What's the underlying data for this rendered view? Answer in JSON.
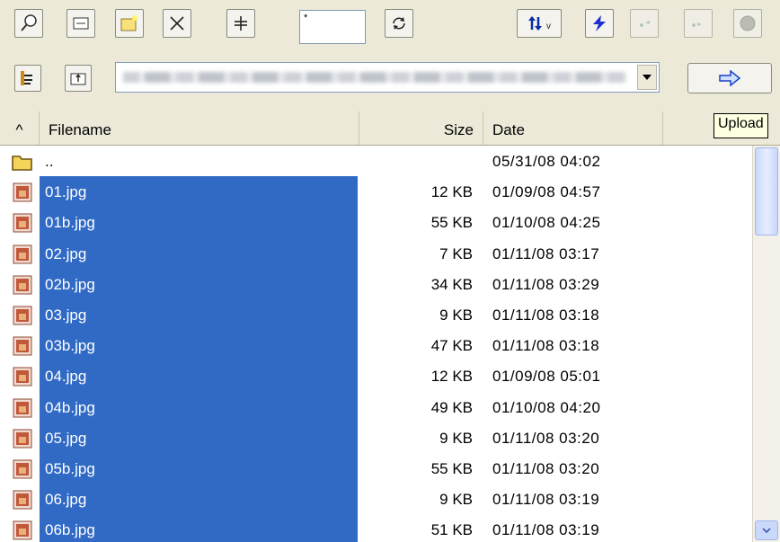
{
  "toolbar": {
    "filemask_value": "*",
    "buttons": [
      "find-icon",
      "window-icon",
      "new-folder-icon",
      "delete-icon",
      "split-icon",
      "refresh-icon",
      "sort-icon",
      "lightning-icon",
      "sync-left-icon",
      "sync-right-icon",
      "stop-icon"
    ]
  },
  "pathbar": {
    "upload_tooltip": "Upload"
  },
  "columns": {
    "sort": "^",
    "filename": "Filename",
    "size": "Size",
    "date": "Date"
  },
  "files": [
    {
      "name": "..",
      "size": "",
      "date": "05/31/08  04:02",
      "type": "folder",
      "selected": false
    },
    {
      "name": "01.jpg",
      "size": "12 KB",
      "date": "01/09/08  04:57",
      "type": "image",
      "selected": true
    },
    {
      "name": "01b.jpg",
      "size": "55 KB",
      "date": "01/10/08  04:25",
      "type": "image",
      "selected": true
    },
    {
      "name": "02.jpg",
      "size": "7 KB",
      "date": "01/11/08  03:17",
      "type": "image",
      "selected": true
    },
    {
      "name": "02b.jpg",
      "size": "34 KB",
      "date": "01/11/08  03:29",
      "type": "image",
      "selected": true
    },
    {
      "name": "03.jpg",
      "size": "9 KB",
      "date": "01/11/08  03:18",
      "type": "image",
      "selected": true
    },
    {
      "name": "03b.jpg",
      "size": "47 KB",
      "date": "01/11/08  03:18",
      "type": "image",
      "selected": true
    },
    {
      "name": "04.jpg",
      "size": "12 KB",
      "date": "01/09/08  05:01",
      "type": "image",
      "selected": true
    },
    {
      "name": "04b.jpg",
      "size": "49 KB",
      "date": "01/10/08  04:20",
      "type": "image",
      "selected": true
    },
    {
      "name": "05.jpg",
      "size": "9 KB",
      "date": "01/11/08  03:20",
      "type": "image",
      "selected": true
    },
    {
      "name": "05b.jpg",
      "size": "55 KB",
      "date": "01/11/08  03:20",
      "type": "image",
      "selected": true
    },
    {
      "name": "06.jpg",
      "size": "9 KB",
      "date": "01/11/08  03:19",
      "type": "image",
      "selected": true
    },
    {
      "name": "06b.jpg",
      "size": "51 KB",
      "date": "01/11/08  03:19",
      "type": "image",
      "selected": true
    }
  ],
  "colors": {
    "selection": "#316ac5",
    "chrome": "#ece9d8"
  }
}
